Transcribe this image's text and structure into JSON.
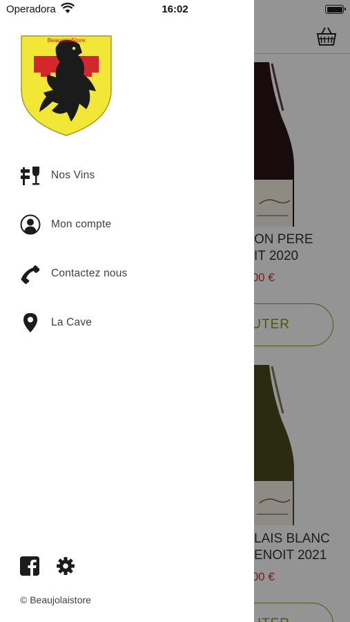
{
  "status_bar": {
    "carrier": "Operadora",
    "time": "16:02"
  },
  "logo": {
    "banner_text": "BeaujolaiStore"
  },
  "menu": {
    "items": [
      {
        "label": "Nos Vins",
        "icon": "wine-tasting-icon"
      },
      {
        "label": "Mon compte",
        "icon": "account-icon"
      },
      {
        "label": "Contactez nous",
        "icon": "phone-icon"
      },
      {
        "label": "La Cave",
        "icon": "location-pin-icon"
      }
    ]
  },
  "footer": {
    "copyright": "© Beaujolaistore",
    "social": [
      "facebook-icon",
      "settings-icon"
    ]
  },
  "background": {
    "products": [
      {
        "title_line1": "ON PERE",
        "title_line2": "IT  2020",
        "price": ",00 €",
        "button": "UTER"
      },
      {
        "title_line1": "LAIS BLANC",
        "title_line2": "ENOIT 2021",
        "price": ",00 €",
        "button": "UTER"
      }
    ]
  },
  "colors": {
    "accent_green": "#7f9a1d",
    "price_red": "#c0392b",
    "logo_yellow": "#f2e636",
    "logo_red": "#d3272b"
  }
}
